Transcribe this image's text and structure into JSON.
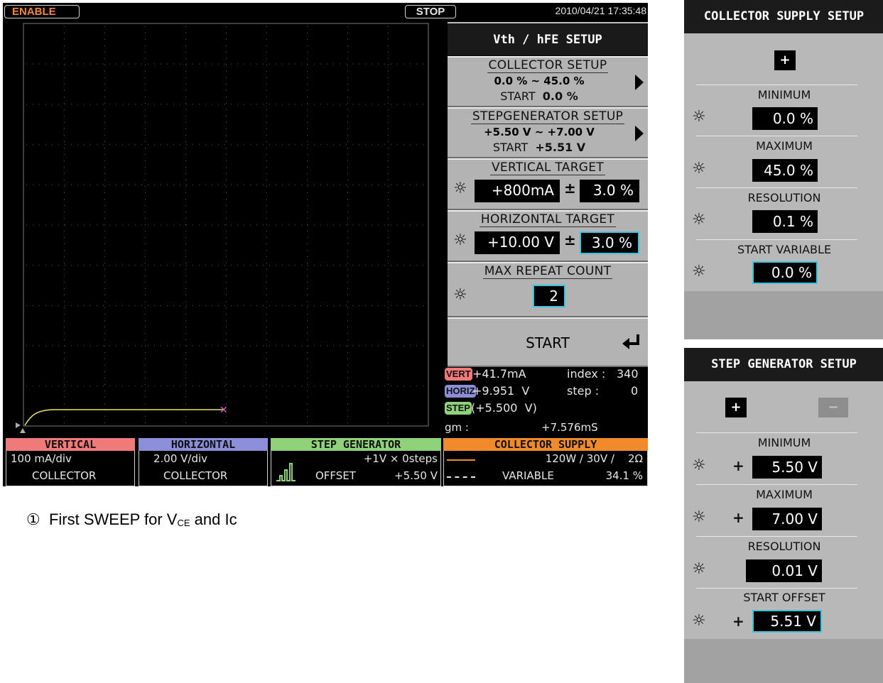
{
  "status": {
    "enable": "ENABLE",
    "stop": "STOP",
    "datetime": "2010/04/21 17:35:48"
  },
  "setup": {
    "title": "Vth / hFE SETUP",
    "collector": {
      "header": "COLLECTOR SETUP",
      "range": "0.0 % ~ 45.0 %",
      "start_label": "START",
      "start_value": "0.0 %"
    },
    "stepgen": {
      "header": "STEPGENERATOR SETUP",
      "range": "+5.50 V ~ +7.00 V",
      "start_label": "START",
      "start_value": "+5.51 V"
    },
    "vertical_target": {
      "header": "VERTICAL TARGET",
      "value": "+800mA",
      "pm": "±",
      "tolerance": "3.0 %"
    },
    "horizontal_target": {
      "header": "HORIZONTAL TARGET",
      "value": "+10.00 V",
      "pm": "±",
      "tolerance": "3.0 %"
    },
    "repeat": {
      "header": "MAX REPEAT COUNT",
      "value": "2"
    },
    "start_button": "START"
  },
  "readout": {
    "vert_tag": "VERT",
    "vert_value": "+41.7mA",
    "index_label": "index :",
    "index_value": "340",
    "horiz_tag": "HORIZ",
    "horiz_value": "+9.951  V",
    "step_label": "step :",
    "step_value": "0",
    "step_tag": "STEP",
    "step_value_paren": "(+5.500  V)",
    "gm_label": "gm :",
    "gm_value": "+7.576mS"
  },
  "bottom": {
    "vertical": {
      "title": "VERTICAL",
      "line1": "100 mA/div",
      "line2": "COLLECTOR"
    },
    "horizontal": {
      "title": "HORIZONTAL",
      "line1": "2.00 V/div",
      "line2": "COLLECTOR"
    },
    "stepgen": {
      "title": "STEP GENERATOR",
      "line1": "+1V × 0steps",
      "offset_label": "OFFSET",
      "offset_value": "+5.50 V"
    },
    "collector": {
      "title": "COLLECTOR SUPPLY",
      "line1": "120W / 30V /    2Ω",
      "line2": "VARIABLE",
      "line2_value": "34.1 %"
    }
  },
  "caption": {
    "num": "①",
    "text_a": "First SWEEP for V",
    "sub": "CE",
    "text_b": " and Ic"
  },
  "collector_panel": {
    "title": "COLLECTOR SUPPLY SETUP",
    "plus": "+",
    "minimum_label": "MINIMUM",
    "minimum_value": "0.0 %",
    "maximum_label": "MAXIMUM",
    "maximum_value": "45.0 %",
    "resolution_label": "RESOLUTION",
    "resolution_value": "0.1 %",
    "start_label": "START VARIABLE",
    "start_value": "0.0 %"
  },
  "step_panel": {
    "title": "STEP GENERATOR SETUP",
    "plus": "+",
    "minus": "−",
    "minimum_label": "MINIMUM",
    "minimum_sign": "+",
    "minimum_value": "5.50 V",
    "maximum_label": "MAXIMUM",
    "maximum_sign": "+",
    "maximum_value": "7.00 V",
    "resolution_label": "RESOLUTION",
    "resolution_value": "0.01 V",
    "start_label": "START OFFSET",
    "start_sign": "+",
    "start_value": "5.51 V"
  },
  "colors": {
    "vertical": "#f07a7a",
    "horizontal": "#8c8ed8",
    "stepgen": "#8fd27a",
    "collector": "#f08a2a",
    "trace": "#e6e66a",
    "cursor": "#e060c0",
    "selected_border": "#36c6e0"
  },
  "icons": {
    "sun": "☼",
    "enter": "enter-arrow-icon",
    "play": "triangle-right-icon",
    "step_waveform": "staircase-icon"
  }
}
